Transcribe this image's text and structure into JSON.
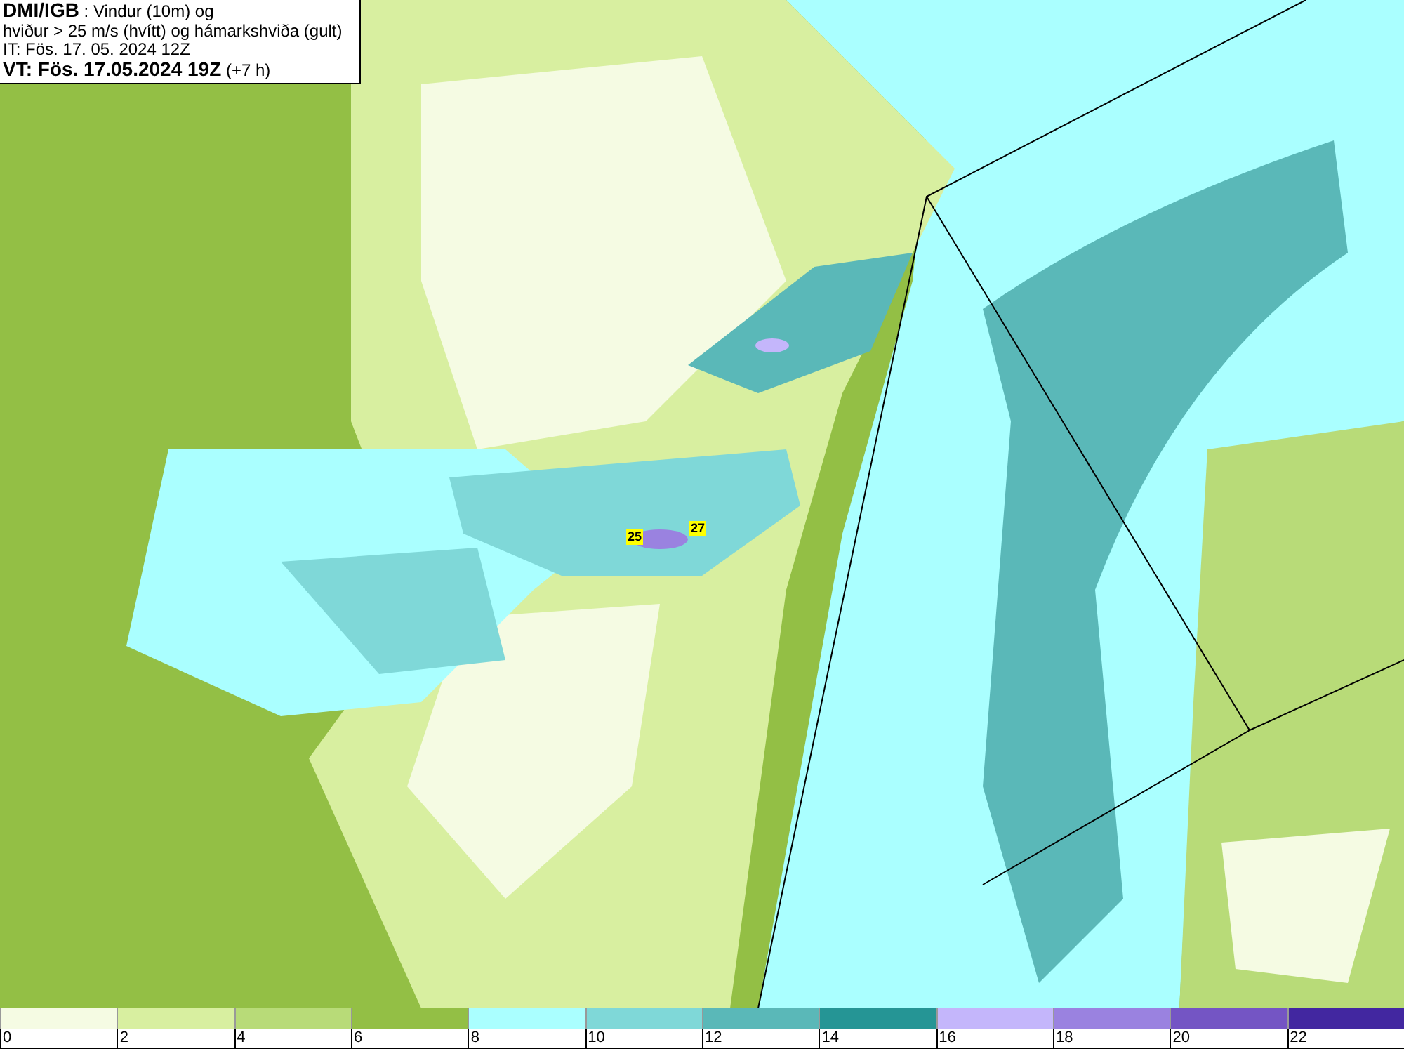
{
  "header": {
    "lines": [
      "**DMI/IGB** : Vindur (10m) og",
      "hviður > 25 m/s (hvítt) og hámarkshviða (gult)",
      "IT: Fös. 17. 05. 2024 12Z",
      "**VT: Fös. 17.05.2024 19Z** (+7 h)"
    ]
  },
  "map": {
    "gust_labels": [
      "25",
      "27"
    ]
  },
  "legend": [
    {
      "label": "0",
      "color": "#f5fbe3"
    },
    {
      "label": "2",
      "color": "#d8efa0"
    },
    {
      "label": "4",
      "color": "#b8db78"
    },
    {
      "label": "6",
      "color": "#93bf45"
    },
    {
      "label": "8",
      "color": "#aaffff"
    },
    {
      "label": "10",
      "color": "#7fd8d8"
    },
    {
      "label": "12",
      "color": "#5ab8b8"
    },
    {
      "label": "14",
      "color": "#259595"
    },
    {
      "label": "16",
      "color": "#c4b6fb"
    },
    {
      "label": "18",
      "color": "#9a82e0"
    },
    {
      "label": "20",
      "color": "#7455c4"
    },
    {
      "label": "22",
      "color": "#4227a0"
    }
  ]
}
